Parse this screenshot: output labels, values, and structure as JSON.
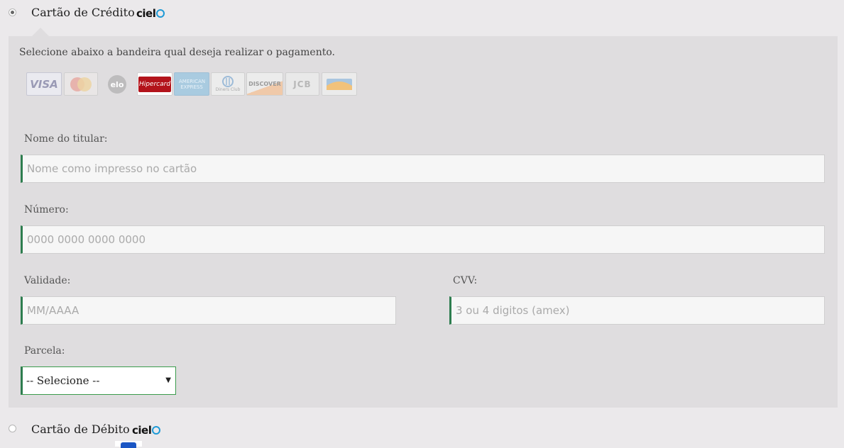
{
  "credit": {
    "label": "Cartão de Crédito",
    "provider": "cielo",
    "selected": true,
    "hint": "Selecione abaixo a bandeira qual deseja realizar o pagamento.",
    "brands": [
      {
        "name": "VISA",
        "icon": "visa-icon"
      },
      {
        "name": "MasterCard",
        "icon": "mastercard-icon"
      },
      {
        "name": "elo",
        "icon": "elo-icon"
      },
      {
        "name": "Hipercard",
        "icon": "hipercard-icon"
      },
      {
        "name": "AMERICAN EXPRESS",
        "icon": "amex-icon"
      },
      {
        "name": "Diners Club",
        "icon": "diners-icon"
      },
      {
        "name": "DISCOVER",
        "icon": "discover-icon"
      },
      {
        "name": "JCB",
        "icon": "jcb-icon"
      },
      {
        "name": "Aura",
        "icon": "aura-icon"
      }
    ],
    "fields": {
      "holder": {
        "label": "Nome do titular:",
        "placeholder": "Nome como impresso no cartão",
        "value": ""
      },
      "number": {
        "label": "Número:",
        "placeholder": "0000 0000 0000 0000",
        "value": ""
      },
      "expiry": {
        "label": "Validade:",
        "placeholder": "MM/AAAA",
        "value": ""
      },
      "cvv": {
        "label": "CVV:",
        "placeholder": "3 ou 4 digitos (amex)",
        "value": ""
      },
      "installments": {
        "label": "Parcela:",
        "selected": "-- Selecione --"
      }
    }
  },
  "debit": {
    "label": "Cartão de Débito",
    "provider": "cielo",
    "selected": false
  },
  "colors": {
    "accent": "#2e7d4f",
    "panel": "#dfdddf",
    "background": "#ebe9eb",
    "cielo_o": "#1e9ad6",
    "hipercard": "#b3131b"
  }
}
